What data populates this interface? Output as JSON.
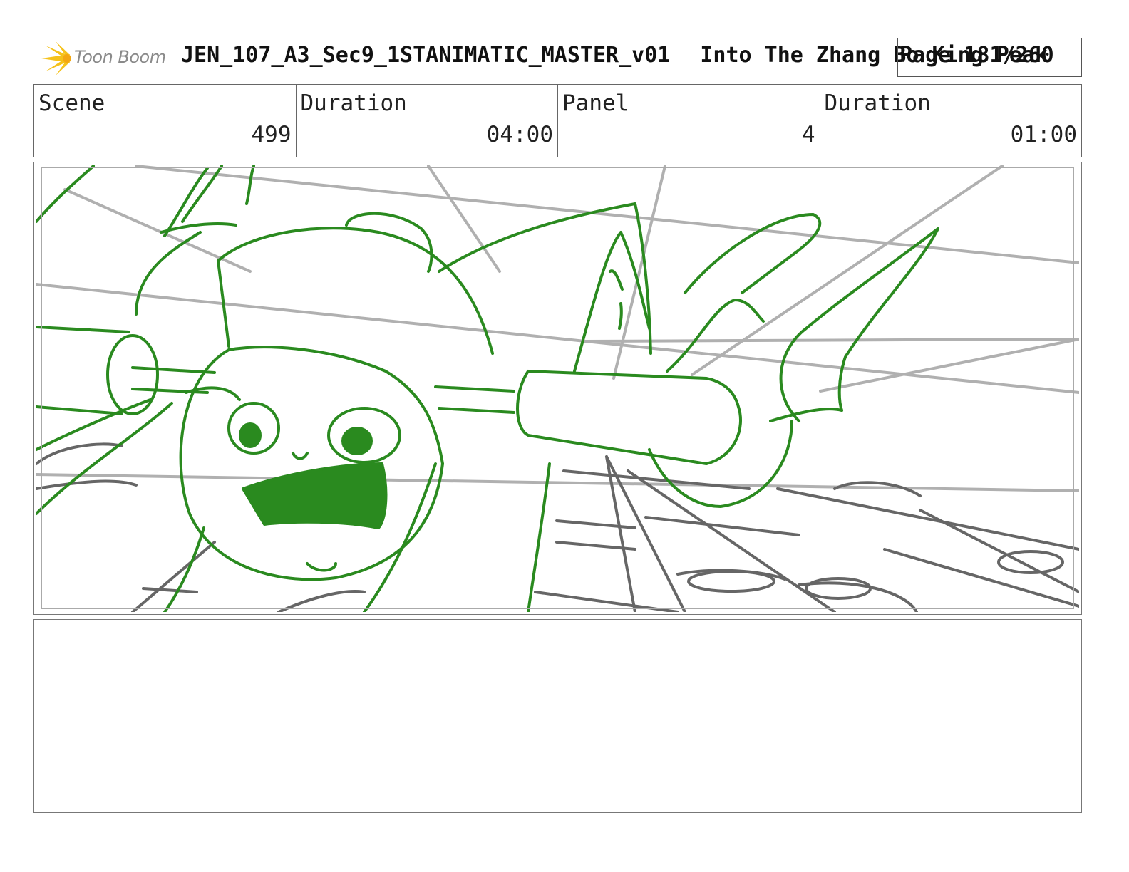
{
  "header": {
    "logo_text": "Toon Boom",
    "file_name": "JEN_107_A3_Sec9_1STANIMATIC_MASTER_v01",
    "project_name": "Into The Zhang Bo King Peak",
    "page_label": "Page 181/260"
  },
  "info_row": {
    "scene_label": "Scene",
    "scene_value": "499",
    "scene_duration_label": "Duration",
    "scene_duration_value": "04:00",
    "panel_label": "Panel",
    "panel_value": "4",
    "panel_duration_label": "Duration",
    "panel_duration_value": "01:00"
  },
  "colors": {
    "sketch_green": "#2a8a1f",
    "sketch_gray": "#666666",
    "guide_gray": "#b0b0b0"
  },
  "notes": {
    "text": ""
  }
}
